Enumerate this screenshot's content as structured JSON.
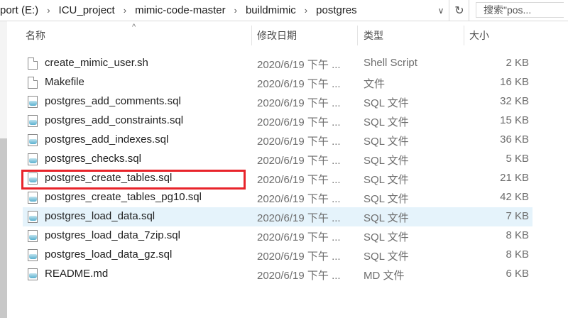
{
  "address_bar": {
    "breadcrumbs": [
      "port (E:)",
      "ICU_project",
      "mimic-code-master",
      "buildmimic",
      "postgres"
    ],
    "dropdown_glyph": "∨",
    "refresh_glyph": "↻",
    "search_placeholder": "搜索\"pos..."
  },
  "columns": {
    "name": "名称",
    "modified": "修改日期",
    "type": "类型",
    "size": "大小",
    "sort_glyph": "^"
  },
  "files": [
    {
      "name": "create_mimic_user.sh",
      "date": "2020/6/19 下午 ...",
      "type": "Shell Script",
      "size": "2 KB",
      "icon": "document-icon"
    },
    {
      "name": "Makefile",
      "date": "2020/6/19 下午 ...",
      "type": "文件",
      "size": "16 KB",
      "icon": "document-icon"
    },
    {
      "name": "postgres_add_comments.sql",
      "date": "2020/6/19 下午 ...",
      "type": "SQL 文件",
      "size": "32 KB",
      "icon": "sql-file-icon"
    },
    {
      "name": "postgres_add_constraints.sql",
      "date": "2020/6/19 下午 ...",
      "type": "SQL 文件",
      "size": "15 KB",
      "icon": "sql-file-icon"
    },
    {
      "name": "postgres_add_indexes.sql",
      "date": "2020/6/19 下午 ...",
      "type": "SQL 文件",
      "size": "36 KB",
      "icon": "sql-file-icon"
    },
    {
      "name": "postgres_checks.sql",
      "date": "2020/6/19 下午 ...",
      "type": "SQL 文件",
      "size": "5 KB",
      "icon": "sql-file-icon"
    },
    {
      "name": "postgres_create_tables.sql",
      "date": "2020/6/19 下午 ...",
      "type": "SQL 文件",
      "size": "21 KB",
      "icon": "sql-file-icon"
    },
    {
      "name": "postgres_create_tables_pg10.sql",
      "date": "2020/6/19 下午 ...",
      "type": "SQL 文件",
      "size": "42 KB",
      "icon": "sql-file-icon"
    },
    {
      "name": "postgres_load_data.sql",
      "date": "2020/6/19 下午 ...",
      "type": "SQL 文件",
      "size": "7 KB",
      "icon": "sql-file-icon",
      "selected": true
    },
    {
      "name": "postgres_load_data_7zip.sql",
      "date": "2020/6/19 下午 ...",
      "type": "SQL 文件",
      "size": "8 KB",
      "icon": "sql-file-icon"
    },
    {
      "name": "postgres_load_data_gz.sql",
      "date": "2020/6/19 下午 ...",
      "type": "SQL 文件",
      "size": "8 KB",
      "icon": "sql-file-icon"
    },
    {
      "name": "README.md",
      "date": "2020/6/19 下午 ...",
      "type": "MD 文件",
      "size": "6 KB",
      "icon": "sql-file-icon"
    }
  ],
  "colors": {
    "selection": "#e5f3fb",
    "highlight_box": "#e8242b"
  }
}
